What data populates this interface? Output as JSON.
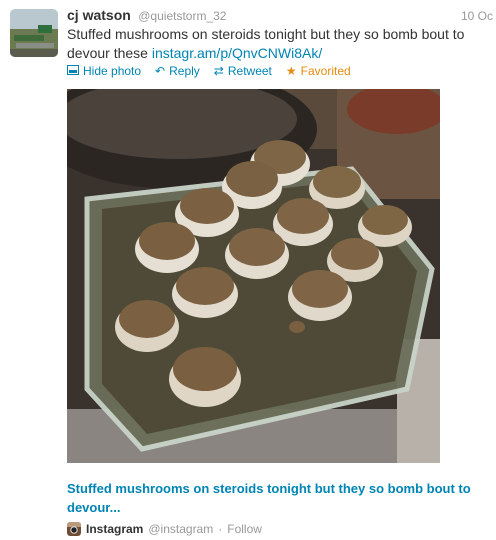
{
  "tweet": {
    "author_name": "cj watson",
    "author_handle": "@quietstorm_32",
    "timestamp": "10 Oc",
    "text": "Stuffed mushrooms on steroids tonight but they so bomb bout to devour these",
    "link": "instagr.am/p/QnvCNWi8Ak/"
  },
  "actions": {
    "hide_photo": "Hide photo",
    "reply": "Reply",
    "retweet": "Retweet",
    "favorited": "Favorited"
  },
  "media": {
    "caption": "Stuffed mushrooms on steroids tonight but they so bomb bout to devour...",
    "source_name": "Instagram",
    "source_handle": "@instagram",
    "follow": "Follow"
  },
  "colors": {
    "link": "#0084b4",
    "favorited": "#e58b0f",
    "muted": "#999999"
  }
}
